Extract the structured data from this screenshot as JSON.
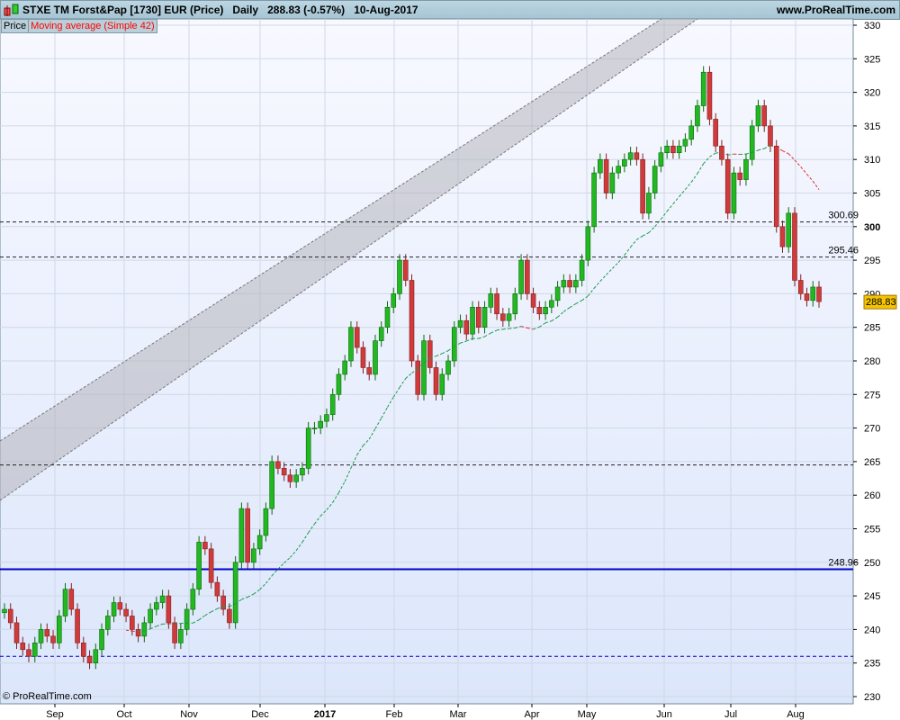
{
  "header": {
    "title": "STXE TM Forst&Pap [1730] EUR (Price)",
    "period": "Daily",
    "last": "288.83 (-0.57%)",
    "date": "10-Aug-2017",
    "site": "www.ProRealTime.com"
  },
  "legend": {
    "price": "Price",
    "ma": "Moving average (Simple 42)"
  },
  "copyright": "© ProRealTime.com",
  "colors": {
    "up": "#22b822",
    "down": "#d03a3a",
    "ma_up": "#1a9a4a",
    "ma_down": "#e03030",
    "level": "#0000cc"
  },
  "chart_data": {
    "type": "candlestick",
    "title": "STXE TM Forst&Pap [1730] EUR (Price) Daily",
    "ylim": [
      230,
      330
    ],
    "yticks": [
      230,
      235,
      240,
      245,
      250,
      255,
      260,
      265,
      270,
      275,
      280,
      285,
      290,
      295,
      300,
      305,
      310,
      315,
      320,
      325,
      330
    ],
    "xticks": [
      "Sep",
      "Oct",
      "Nov",
      "Dec",
      "2017",
      "Feb",
      "Mar",
      "Apr",
      "May",
      "Jun",
      "Jul",
      "Aug"
    ],
    "closes": [
      243,
      241,
      238,
      237,
      236,
      238,
      240,
      239,
      238,
      242,
      246,
      243,
      238,
      236,
      235,
      237,
      240,
      242,
      244,
      243,
      242,
      240,
      239,
      241,
      243,
      244,
      245,
      241,
      238,
      240,
      243,
      246,
      253,
      252,
      247,
      245,
      243,
      241,
      250,
      258,
      250,
      252,
      254,
      258,
      265,
      264,
      263,
      262,
      263,
      264,
      270,
      270,
      271,
      272,
      275,
      278,
      280,
      285,
      282,
      279,
      278,
      283,
      285,
      288,
      290,
      295,
      292,
      280,
      275,
      283,
      279,
      275,
      278,
      280,
      285,
      286,
      284,
      288,
      285,
      288,
      290,
      287,
      286,
      287,
      290,
      295,
      290,
      288,
      287,
      288,
      289,
      291,
      292,
      291,
      292,
      295,
      300,
      308,
      310,
      305,
      308,
      309,
      310,
      311,
      310,
      302,
      305,
      309,
      311,
      312,
      311,
      312,
      313,
      315,
      318,
      323,
      316,
      312,
      310,
      302,
      308,
      307,
      310,
      315,
      318,
      315,
      312,
      300,
      297,
      302,
      292,
      290,
      289,
      291,
      288.83
    ],
    "ma_period_points": 21,
    "levels": [
      {
        "value": 300.69,
        "label": "300.69",
        "style": "dashed"
      },
      {
        "value": 295.46,
        "label": "295.46",
        "style": "dashed"
      },
      {
        "value": 264.5,
        "label": "",
        "style": "dashed"
      },
      {
        "value": 248.96,
        "label": "248.96",
        "style": "solid"
      },
      {
        "value": 236,
        "label": "",
        "style": "dashed-blue"
      }
    ],
    "last_price": "288.83"
  }
}
